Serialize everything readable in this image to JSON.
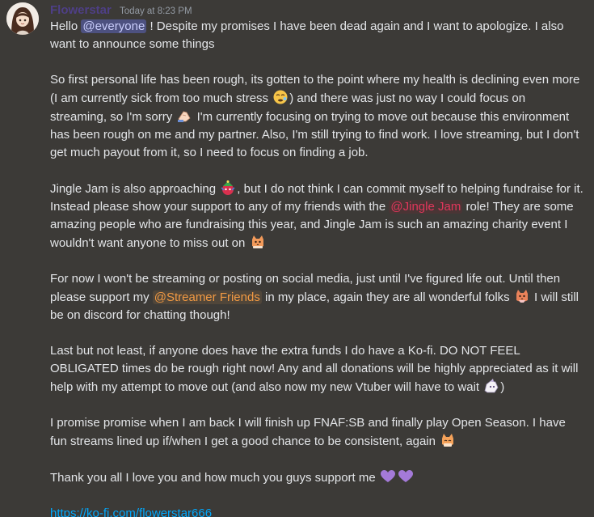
{
  "message": {
    "author": "Flowerstar",
    "timestamp": "Today at 8:23 PM",
    "p1": {
      "a": "Hello ",
      "mention": "@everyone",
      "b": " ! Despite my promises I have been dead again and I want to apologize. I also want to announce some things"
    },
    "p2": {
      "a": "So first personal life has been rough, its gotten to the point where my health is declining even more (I am currently sick from too much stress ",
      "b": ") and there was just no way I could focus on streaming, so I'm sorry ",
      "c": " I'm currently focusing on trying to move out because this environment has been rough on me and my partner. Also, I'm still trying to find work. I love streaming, but I don't get much payout from it, so I need to focus on finding a job."
    },
    "p3": {
      "a": "Jingle Jam is also approaching ",
      "b": ", but I do not think I can commit myself to helping fundraise for it. Instead please show your support to any of my friends with the ",
      "mention": "@Jingle Jam",
      "c": " role! They are some amazing people who are fundraising this year, and Jingle Jam is such an amazing charity event I wouldn't want anyone to miss out on "
    },
    "p4": {
      "a": "For now I won't be streaming or posting on social media, just until I've figured life out. Until then please support my ",
      "mention": "@Streamer Friends",
      "b": " in my place, again they are all wonderful folks ",
      "c": " I will still be on discord for chatting though!"
    },
    "p5": {
      "a": "Last but not least, if anyone does have the extra funds I do have a Ko-fi. DO NOT FEEL OBLIGATED times do be rough right now! Any and all donations will be highly appreciated as it will help with my attempt to move out (and also now my new Vtuber will have to wait ",
      "b": ")"
    },
    "p6": {
      "a": "I promise promise when I am back I will finish up FNAF:SB and finally play Open Season. I have fun streams lined up if/when I get a good chance to be consistent, again "
    },
    "p7": {
      "a": "Thank you all I love you and how much you guys support me "
    },
    "link": "https://ko-fi.com/flowerstar666"
  },
  "colors": {
    "background": "#3c3a37",
    "username": "#4e3f86",
    "link": "#00a8fc",
    "mention_everyone": "#c9cdfb",
    "mention_jingle_jam": "#e0365b",
    "mention_streamer_friends": "#f29a43"
  },
  "icons": {
    "avatar": "avatar-image",
    "emoji_1": "dizzy-tired-face-emoji",
    "emoji_2": "sorry-hand-emoji",
    "emoji_3": "jingle-jam-emoji",
    "emoji_4": "cat-emoji",
    "emoji_5": "cat-emoji",
    "emoji_6": "vtuber-emoji",
    "emoji_7": "cat-emoji",
    "emoji_8": "purple-heart-emoji"
  }
}
